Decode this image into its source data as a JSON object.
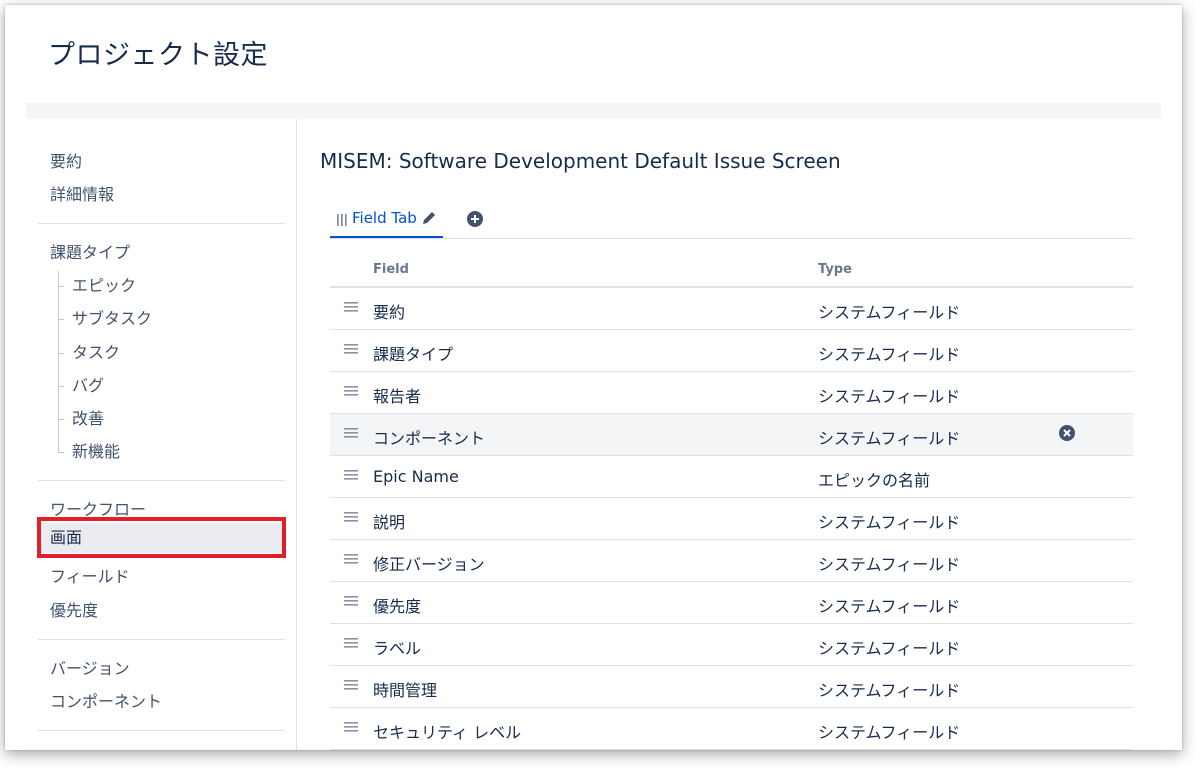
{
  "header": {
    "title": "プロジェクト設定"
  },
  "sidebar": {
    "groups": [
      {
        "items": [
          {
            "label": "要約"
          },
          {
            "label": "詳細情報"
          }
        ]
      },
      {
        "items": [
          {
            "label": "課題タイプ"
          }
        ],
        "subitems": [
          {
            "label": "エピック"
          },
          {
            "label": "サブタスク"
          },
          {
            "label": "タスク"
          },
          {
            "label": "バグ"
          },
          {
            "label": "改善"
          },
          {
            "label": "新機能"
          }
        ]
      },
      {
        "items": [
          {
            "label": "ワークフロー"
          },
          {
            "label": "画面",
            "selected": true
          },
          {
            "label": "フィールド"
          },
          {
            "label": "優先度"
          }
        ]
      },
      {
        "items": [
          {
            "label": "バージョン"
          },
          {
            "label": "コンポーネント"
          }
        ]
      }
    ]
  },
  "main": {
    "title": "MISEM: Software Development Default Issue Screen",
    "tabs": [
      {
        "label": "Field Tab"
      }
    ],
    "icons": {
      "grip": "grip-icon",
      "edit": "pencil-icon",
      "add": "plus-circle-icon",
      "drag": "drag-handle-icon",
      "remove": "remove-circle-icon"
    },
    "table": {
      "columns": [
        "Field",
        "Type"
      ],
      "rows": [
        {
          "field": "要約",
          "type": "システムフィールド"
        },
        {
          "field": "課題タイプ",
          "type": "システムフィールド"
        },
        {
          "field": "報告者",
          "type": "システムフィールド"
        },
        {
          "field": "コンポーネント",
          "type": "システムフィールド",
          "hover": true
        },
        {
          "field": "Epic Name",
          "type": "エピックの名前"
        },
        {
          "field": "説明",
          "type": "システムフィールド"
        },
        {
          "field": "修正バージョン",
          "type": "システムフィールド"
        },
        {
          "field": "優先度",
          "type": "システムフィールド"
        },
        {
          "field": "ラベル",
          "type": "システムフィールド"
        },
        {
          "field": "時間管理",
          "type": "システムフィールド"
        },
        {
          "field": "セキュリティ レベル",
          "type": "システムフィールド"
        }
      ]
    }
  },
  "colors": {
    "accent": "#0052cc",
    "highlight": "#e01f2a",
    "text": "#172b4d",
    "muted": "#42526e"
  }
}
